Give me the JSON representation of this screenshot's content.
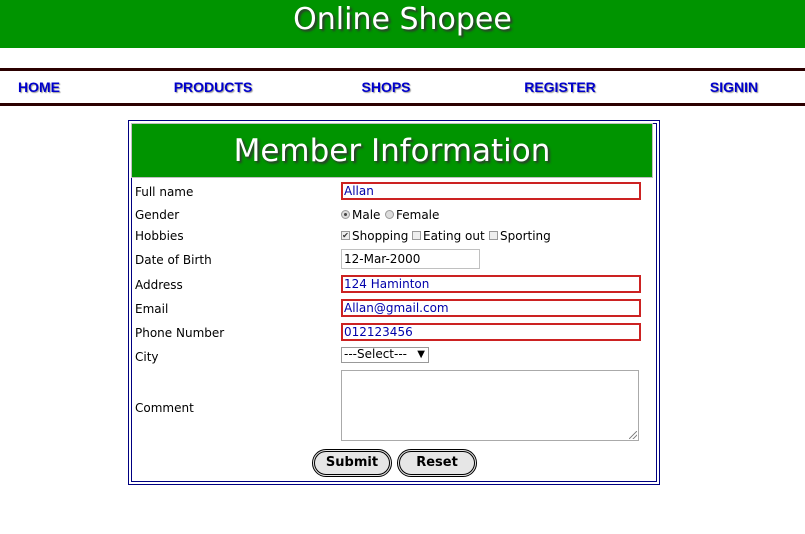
{
  "header": {
    "title": "Online Shopee"
  },
  "nav": {
    "items": [
      "HOME",
      "PRODUCTS",
      "SHOPS",
      "REGISTER",
      "SIGNIN"
    ]
  },
  "form": {
    "title": "Member Information",
    "labels": {
      "full_name": "Full name",
      "gender": "Gender",
      "hobbies": "Hobbies",
      "dob": "Date of Birth",
      "address": "Address",
      "email": "Email",
      "phone": "Phone Number",
      "city": "City",
      "comment": "Comment"
    },
    "values": {
      "full_name": "Allan",
      "dob": "12-Mar-2000",
      "address": "124 Haminton",
      "email": "Allan@gmail.com",
      "phone": "012123456",
      "city": "---Select---",
      "comment": ""
    },
    "gender_options": {
      "male": "Male",
      "female": "Female"
    },
    "gender_selected": "Male",
    "hobby_options": {
      "shopping": "Shopping",
      "eating_out": "Eating out",
      "sporting": "Sporting"
    },
    "hobbies_checked": [
      "Shopping"
    ],
    "buttons": {
      "submit": "Submit",
      "reset": "Reset"
    }
  },
  "colors": {
    "header_bg": "#009400",
    "nav_link": "#0000cc",
    "error_border": "#cc2222"
  }
}
